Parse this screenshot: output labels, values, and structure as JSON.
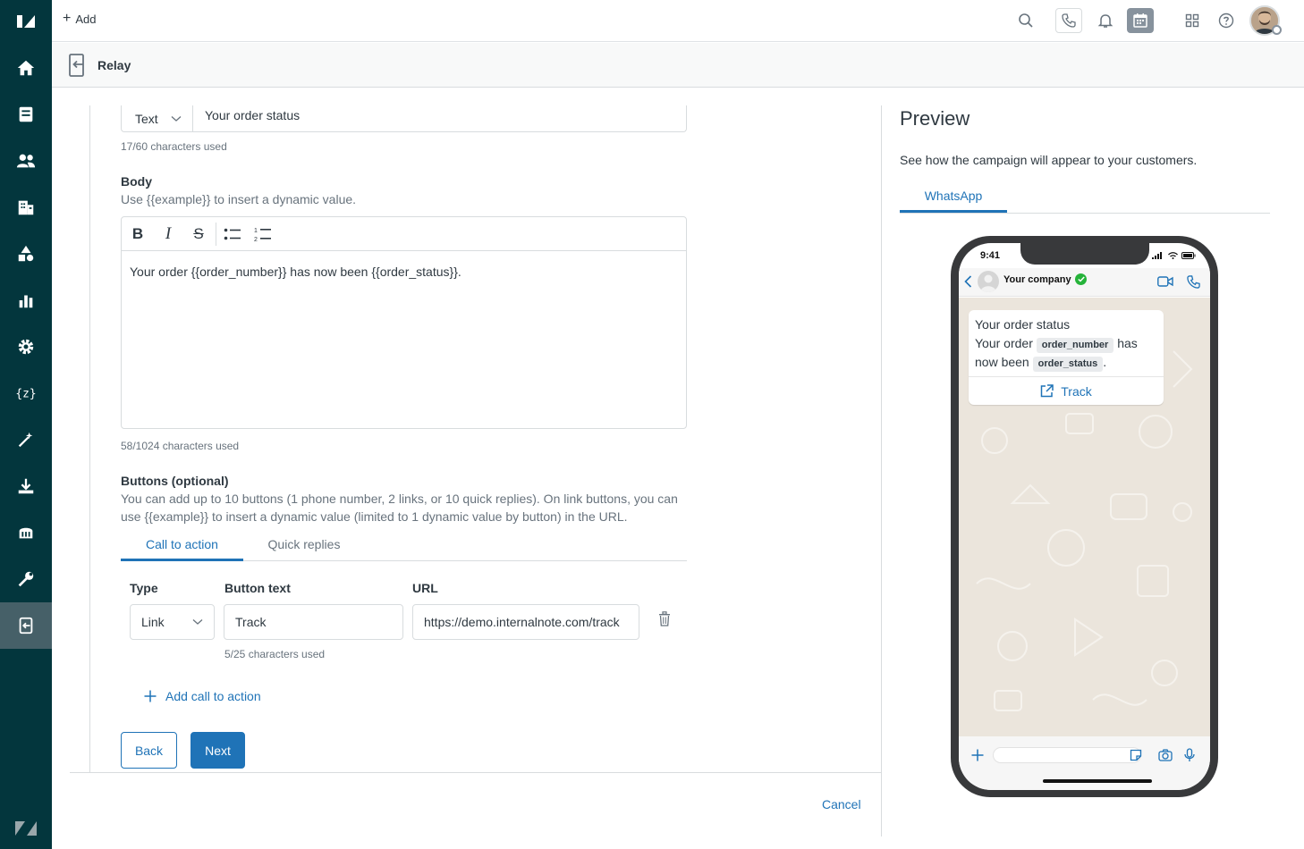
{
  "topbar": {
    "add_label": "Add"
  },
  "product": {
    "title": "Relay"
  },
  "subject": {
    "type_value": "Text",
    "value": "Your order status",
    "char_count": "17/60 characters used"
  },
  "body": {
    "label": "Body",
    "description": "Use {{example}} to insert a dynamic value.",
    "toolbar": {
      "bold": "B",
      "italic": "I",
      "strike": "S"
    },
    "content": "Your order {{order_number}} has now been {{order_status}}.",
    "char_count": "58/1024 characters used"
  },
  "buttons_section": {
    "label": "Buttons (optional)",
    "description_line1": "You can add up to 10 buttons (1 phone number, 2 links, or 10 quick replies). On link buttons, you can",
    "description_line2": "use {{example}} to insert a dynamic value (limited to 1 dynamic value by button) in the URL.",
    "tabs": [
      {
        "label": "Call to action",
        "active": true
      },
      {
        "label": "Quick replies",
        "active": false
      }
    ],
    "columns": {
      "type": "Type",
      "button_text": "Button text",
      "url": "URL"
    },
    "row": {
      "type": "Link",
      "button_text": "Track",
      "url": "https://demo.internalnote.com/track",
      "text_char_count": "5/25 characters used"
    },
    "add_label": "Add call to action"
  },
  "actions": {
    "back": "Back",
    "next": "Next",
    "cancel": "Cancel"
  },
  "preview": {
    "title": "Preview",
    "description": "See how the campaign will appear to your customers.",
    "tab": "WhatsApp",
    "phone": {
      "time": "9:41",
      "company": "Your company",
      "message_title": "Your order status",
      "message_part1": "Your order",
      "chip1": "order_number",
      "message_part2": "has",
      "message_part3": "now been",
      "chip2": "order_status",
      "message_end": ".",
      "button_label": "Track"
    }
  },
  "colors": {
    "sidebar": "#03363d",
    "accent": "#1f73b7",
    "verified": "#26b33a"
  }
}
